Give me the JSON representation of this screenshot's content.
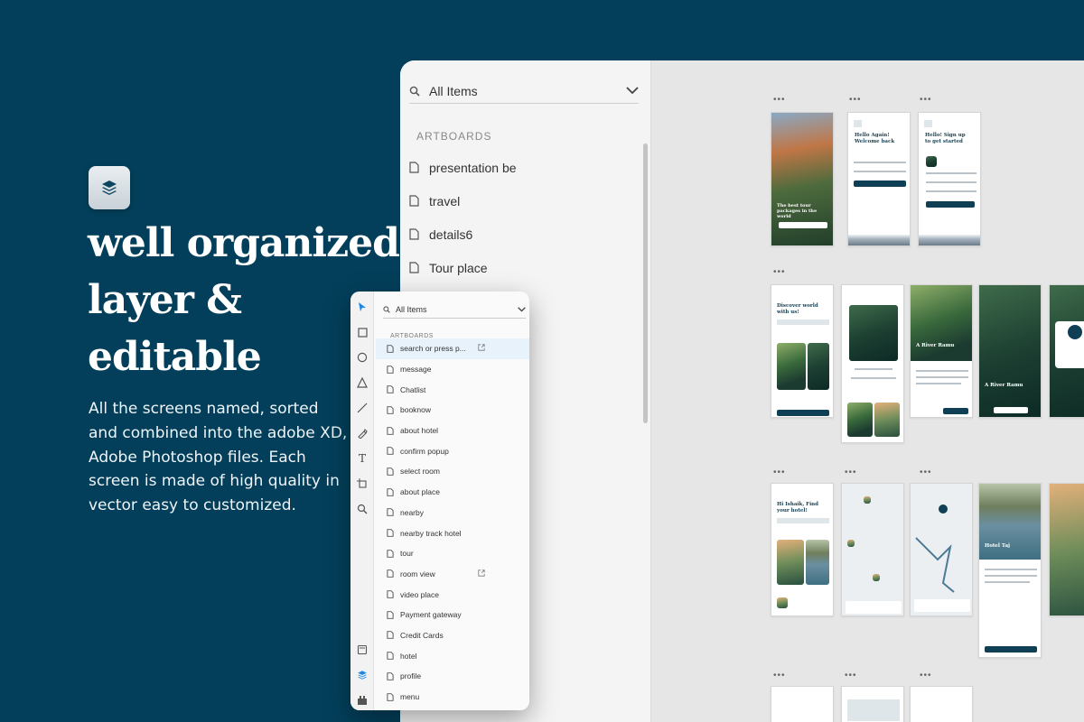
{
  "promo": {
    "headline_line1": "well organized",
    "headline_line2": "layer &",
    "headline_line3": "editable",
    "description": "All the screens named, sorted and combined into the adobe XD, Adobe Photoshop files. Each screen is made of high quality in vector easy to customized.",
    "badge_icon": "layers-icon"
  },
  "colors": {
    "background": "#033f5a",
    "accent": "#0f3f55",
    "selection": "#e8f2fb"
  },
  "big_panel": {
    "search_value": "All Items",
    "section_label": "ARTBOARDS",
    "items": [
      "presentation be",
      "travel",
      "details6",
      "Tour place"
    ]
  },
  "small_panel": {
    "search_value": "All Items",
    "section_label": "ARTBOARDS",
    "items": [
      {
        "label": "search or press p...",
        "active": true,
        "external": true
      },
      {
        "label": "message"
      },
      {
        "label": "Chatlist"
      },
      {
        "label": "booknow"
      },
      {
        "label": "about hotel"
      },
      {
        "label": "confirm popup"
      },
      {
        "label": "select room"
      },
      {
        "label": "about place"
      },
      {
        "label": "nearby"
      },
      {
        "label": "nearby track hotel"
      },
      {
        "label": "tour"
      },
      {
        "label": "room view",
        "external": true
      },
      {
        "label": "video place"
      },
      {
        "label": "Payment gateway"
      },
      {
        "label": "Credit Cards"
      },
      {
        "label": "hotel"
      },
      {
        "label": "profile"
      },
      {
        "label": "menu"
      }
    ],
    "tools": [
      "select-tool",
      "rectangle-tool",
      "ellipse-tool",
      "polygon-tool",
      "line-tool",
      "pen-tool",
      "text-tool",
      "artboard-tool",
      "zoom-tool",
      "assets-tool",
      "layers-tool",
      "plugins-tool"
    ]
  },
  "artboards": {
    "row1": {
      "screen1_caption": "The best tour packages in the world",
      "screen2_title": "Hello Again! Welcome back",
      "screen3_title": "Hello! Sign up to get started"
    },
    "row2": {
      "screen1_title": "Discover world with us!",
      "screen3_title": "A River Ramu",
      "screen4_title": "A River Ramu"
    },
    "row3": {
      "screen1_title": "Hi Ishaik, Find your hotel!",
      "screen4_title": "Hotel Taj"
    }
  }
}
